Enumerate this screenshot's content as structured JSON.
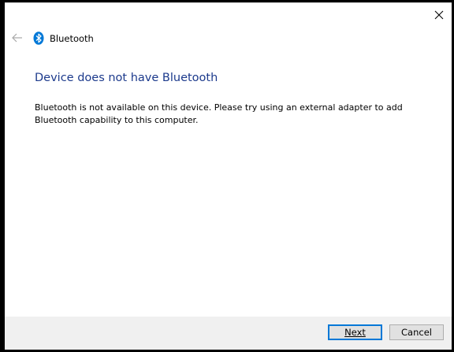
{
  "window": {
    "title": "Bluetooth"
  },
  "content": {
    "heading": "Device does not have Bluetooth",
    "message": "Bluetooth is not available on this device. Please try using an external adapter to add Bluetooth capability to this computer."
  },
  "footer": {
    "next_label": "Next",
    "cancel_label": "Cancel"
  },
  "icons": {
    "close": "close-icon",
    "back": "back-arrow-icon",
    "bluetooth": "bluetooth-icon"
  },
  "colors": {
    "heading": "#1c3a8c",
    "bluetooth_icon": "#0078d7",
    "footer_bg": "#f0f0f0",
    "default_button_border": "#0078d7"
  }
}
